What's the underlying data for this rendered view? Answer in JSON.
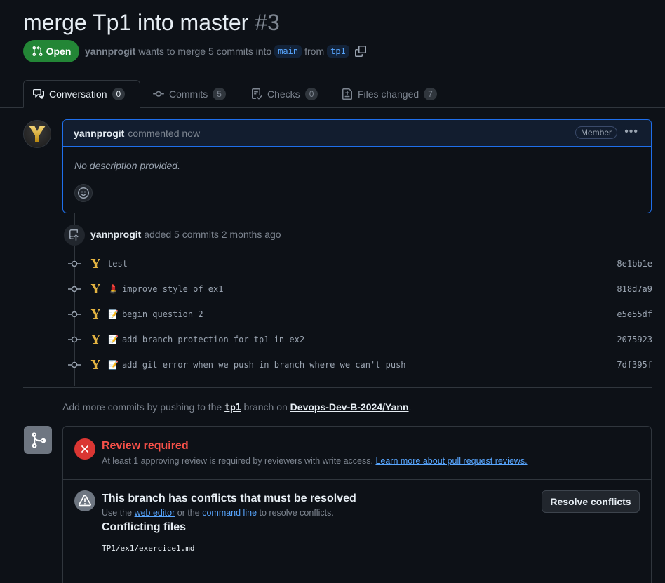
{
  "pr": {
    "title": "merge Tp1 into master",
    "number": "#3",
    "state": "Open",
    "author": "yannprogit",
    "meta_text": "wants to merge 5 commits into",
    "base_branch": "main",
    "from_text": "from",
    "head_branch": "tp1"
  },
  "tabs": [
    {
      "label": "Conversation",
      "count": "0",
      "icon": "comment-discussion-icon"
    },
    {
      "label": "Commits",
      "count": "5",
      "icon": "git-commit-icon"
    },
    {
      "label": "Checks",
      "count": "0",
      "icon": "checklist-icon"
    },
    {
      "label": "Files changed",
      "count": "7",
      "icon": "file-diff-icon"
    }
  ],
  "comment": {
    "author": "yannprogit",
    "action": "commented now",
    "role": "Member",
    "body": "No description provided."
  },
  "commits_event": {
    "author": "yannprogit",
    "text": "added 5 commits",
    "time": "2 months ago"
  },
  "commits": [
    {
      "emoji": "",
      "message": "test",
      "sha": "8e1bb1e"
    },
    {
      "emoji": "💄",
      "message": "improve style of ex1",
      "sha": "818d7a9"
    },
    {
      "emoji": "📝",
      "message": "begin question 2",
      "sha": "e5e55df"
    },
    {
      "emoji": "📝",
      "message": "add branch protection for tp1 in ex2",
      "sha": "2075923"
    },
    {
      "emoji": "📝",
      "message": "add git error when we push in branch where we can't push",
      "sha": "7df395f"
    }
  ],
  "push_hint": {
    "prefix": "Add more commits by pushing to the",
    "branch": "tp1",
    "middle": "branch on",
    "repo": "Devops-Dev-B-2024/Yann",
    "suffix": "."
  },
  "review": {
    "title": "Review required",
    "desc": "At least 1 approving review is required by reviewers with write access.",
    "link": "Learn more about pull request reviews."
  },
  "conflicts": {
    "title": "This branch has conflicts that must be resolved",
    "desc_prefix": "Use the",
    "web_editor": "web editor",
    "desc_or": "or the",
    "command_line": "command line",
    "desc_suffix": "to resolve conflicts.",
    "button": "Resolve conflicts",
    "files_title": "Conflicting files",
    "files": [
      "TP1/ex1/exercice1.md"
    ]
  },
  "colors": {
    "open_green": "#238636",
    "accent_blue": "#58a6ff",
    "danger_red": "#da3633",
    "avatar_gold": "#e3b341"
  }
}
